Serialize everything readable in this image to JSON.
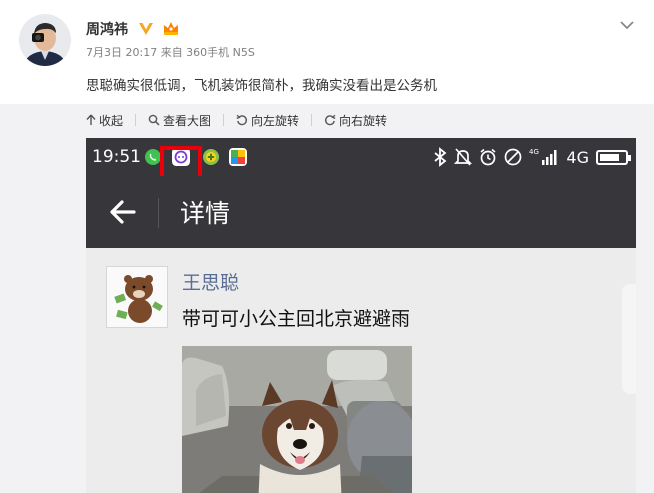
{
  "post": {
    "author": "周鸿祎",
    "meta": "7月3日 20:17 来自 360手机 N5S",
    "text": "思聪确实很低调，飞机装饰很简朴，我确实没看出是公务机"
  },
  "toolbar": {
    "collapse": "收起",
    "view_large": "查看大图",
    "rotate_left": "向左旋转",
    "rotate_right": "向右旋转"
  },
  "phone": {
    "time": "19:51",
    "network": "4G",
    "network_small": "4G",
    "battery_level": 0.8,
    "nav_title": "详情",
    "card": {
      "name": "王思聪",
      "text": "带可可小公主回北京避避雨"
    }
  },
  "colors": {
    "highlight": "#e8000b",
    "status_bar": "#37373b",
    "link_name": "#5a6e93",
    "verified": "#f5a623"
  }
}
